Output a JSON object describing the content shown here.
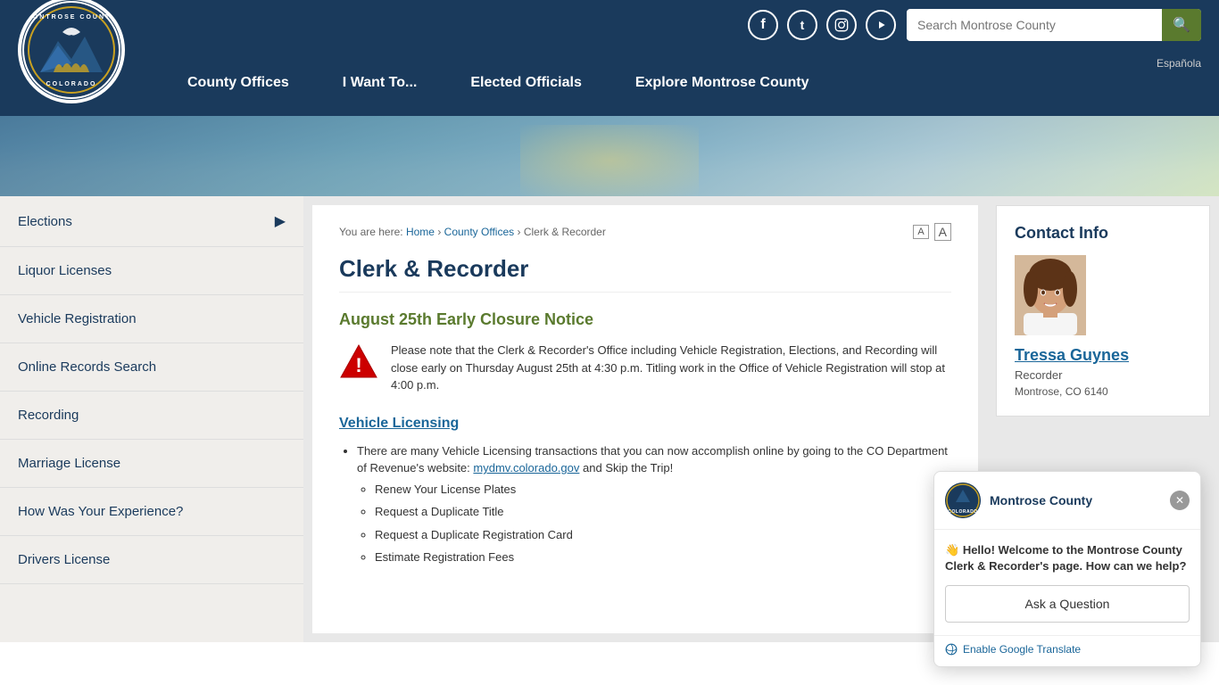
{
  "header": {
    "social": {
      "facebook_label": "f",
      "twitter_label": "t",
      "instagram_label": "📷",
      "youtube_label": "▶"
    },
    "search_placeholder": "Search Montrose County",
    "search_button_label": "🔍",
    "espanol_label": "Española",
    "nav": {
      "county_offices": "County Offices",
      "i_want_to": "I Want To...",
      "elected_officials": "Elected Officials",
      "explore": "Explore Montrose County"
    },
    "logo_alt": "Montrose County Colorado"
  },
  "breadcrumb": {
    "home": "Home",
    "county_offices": "County Offices",
    "current": "Clerk & Recorder",
    "separator": "›"
  },
  "font_controls": {
    "decrease": "A",
    "increase": "A"
  },
  "sidebar": {
    "items": [
      {
        "label": "Elections",
        "has_arrow": true
      },
      {
        "label": "Liquor Licenses",
        "has_arrow": false
      },
      {
        "label": "Vehicle Registration",
        "has_arrow": false
      },
      {
        "label": "Online Records Search",
        "has_arrow": false
      },
      {
        "label": "Recording",
        "has_arrow": false
      },
      {
        "label": "Marriage License",
        "has_arrow": false
      },
      {
        "label": "How Was Your Experience?",
        "has_arrow": false
      },
      {
        "label": "Drivers License",
        "has_arrow": false
      }
    ]
  },
  "page": {
    "title": "Clerk & Recorder",
    "notice_heading": "August 25th Early Closure Notice",
    "notice_text": "Please note that the Clerk & Recorder's Office including Vehicle Registration, Elections, and Recording will close early on Thursday August 25th at 4:30 p.m. Titling work in the Office of Vehicle Registration will stop at 4:00 p.m.",
    "section_heading": "Vehicle Licensing",
    "intro_text": "There are many Vehicle Licensing transactions that you can now accomplish online by going to the CO Department of Revenue's website:",
    "link_text": "mydmv.colorado.gov",
    "link_suffix": " and Skip the Trip!",
    "list_items": [
      "Renew Your License Plates",
      "Request a Duplicate Title",
      "Request a Duplicate Registration Card",
      "Estimate Registration Fees"
    ]
  },
  "contact": {
    "title": "Contact Info",
    "name": "Tressa Guynes",
    "role": "Recorder",
    "address": "Montrose, CO 6140"
  },
  "chat": {
    "org_name": "Montrose County",
    "greeting_emoji": "👋",
    "message": "Hello! Welcome to the Montrose County Clerk & Recorder's page. How can we help?",
    "ask_button": "Ask a Question"
  },
  "translate": {
    "label": "Enable Google Translate"
  }
}
